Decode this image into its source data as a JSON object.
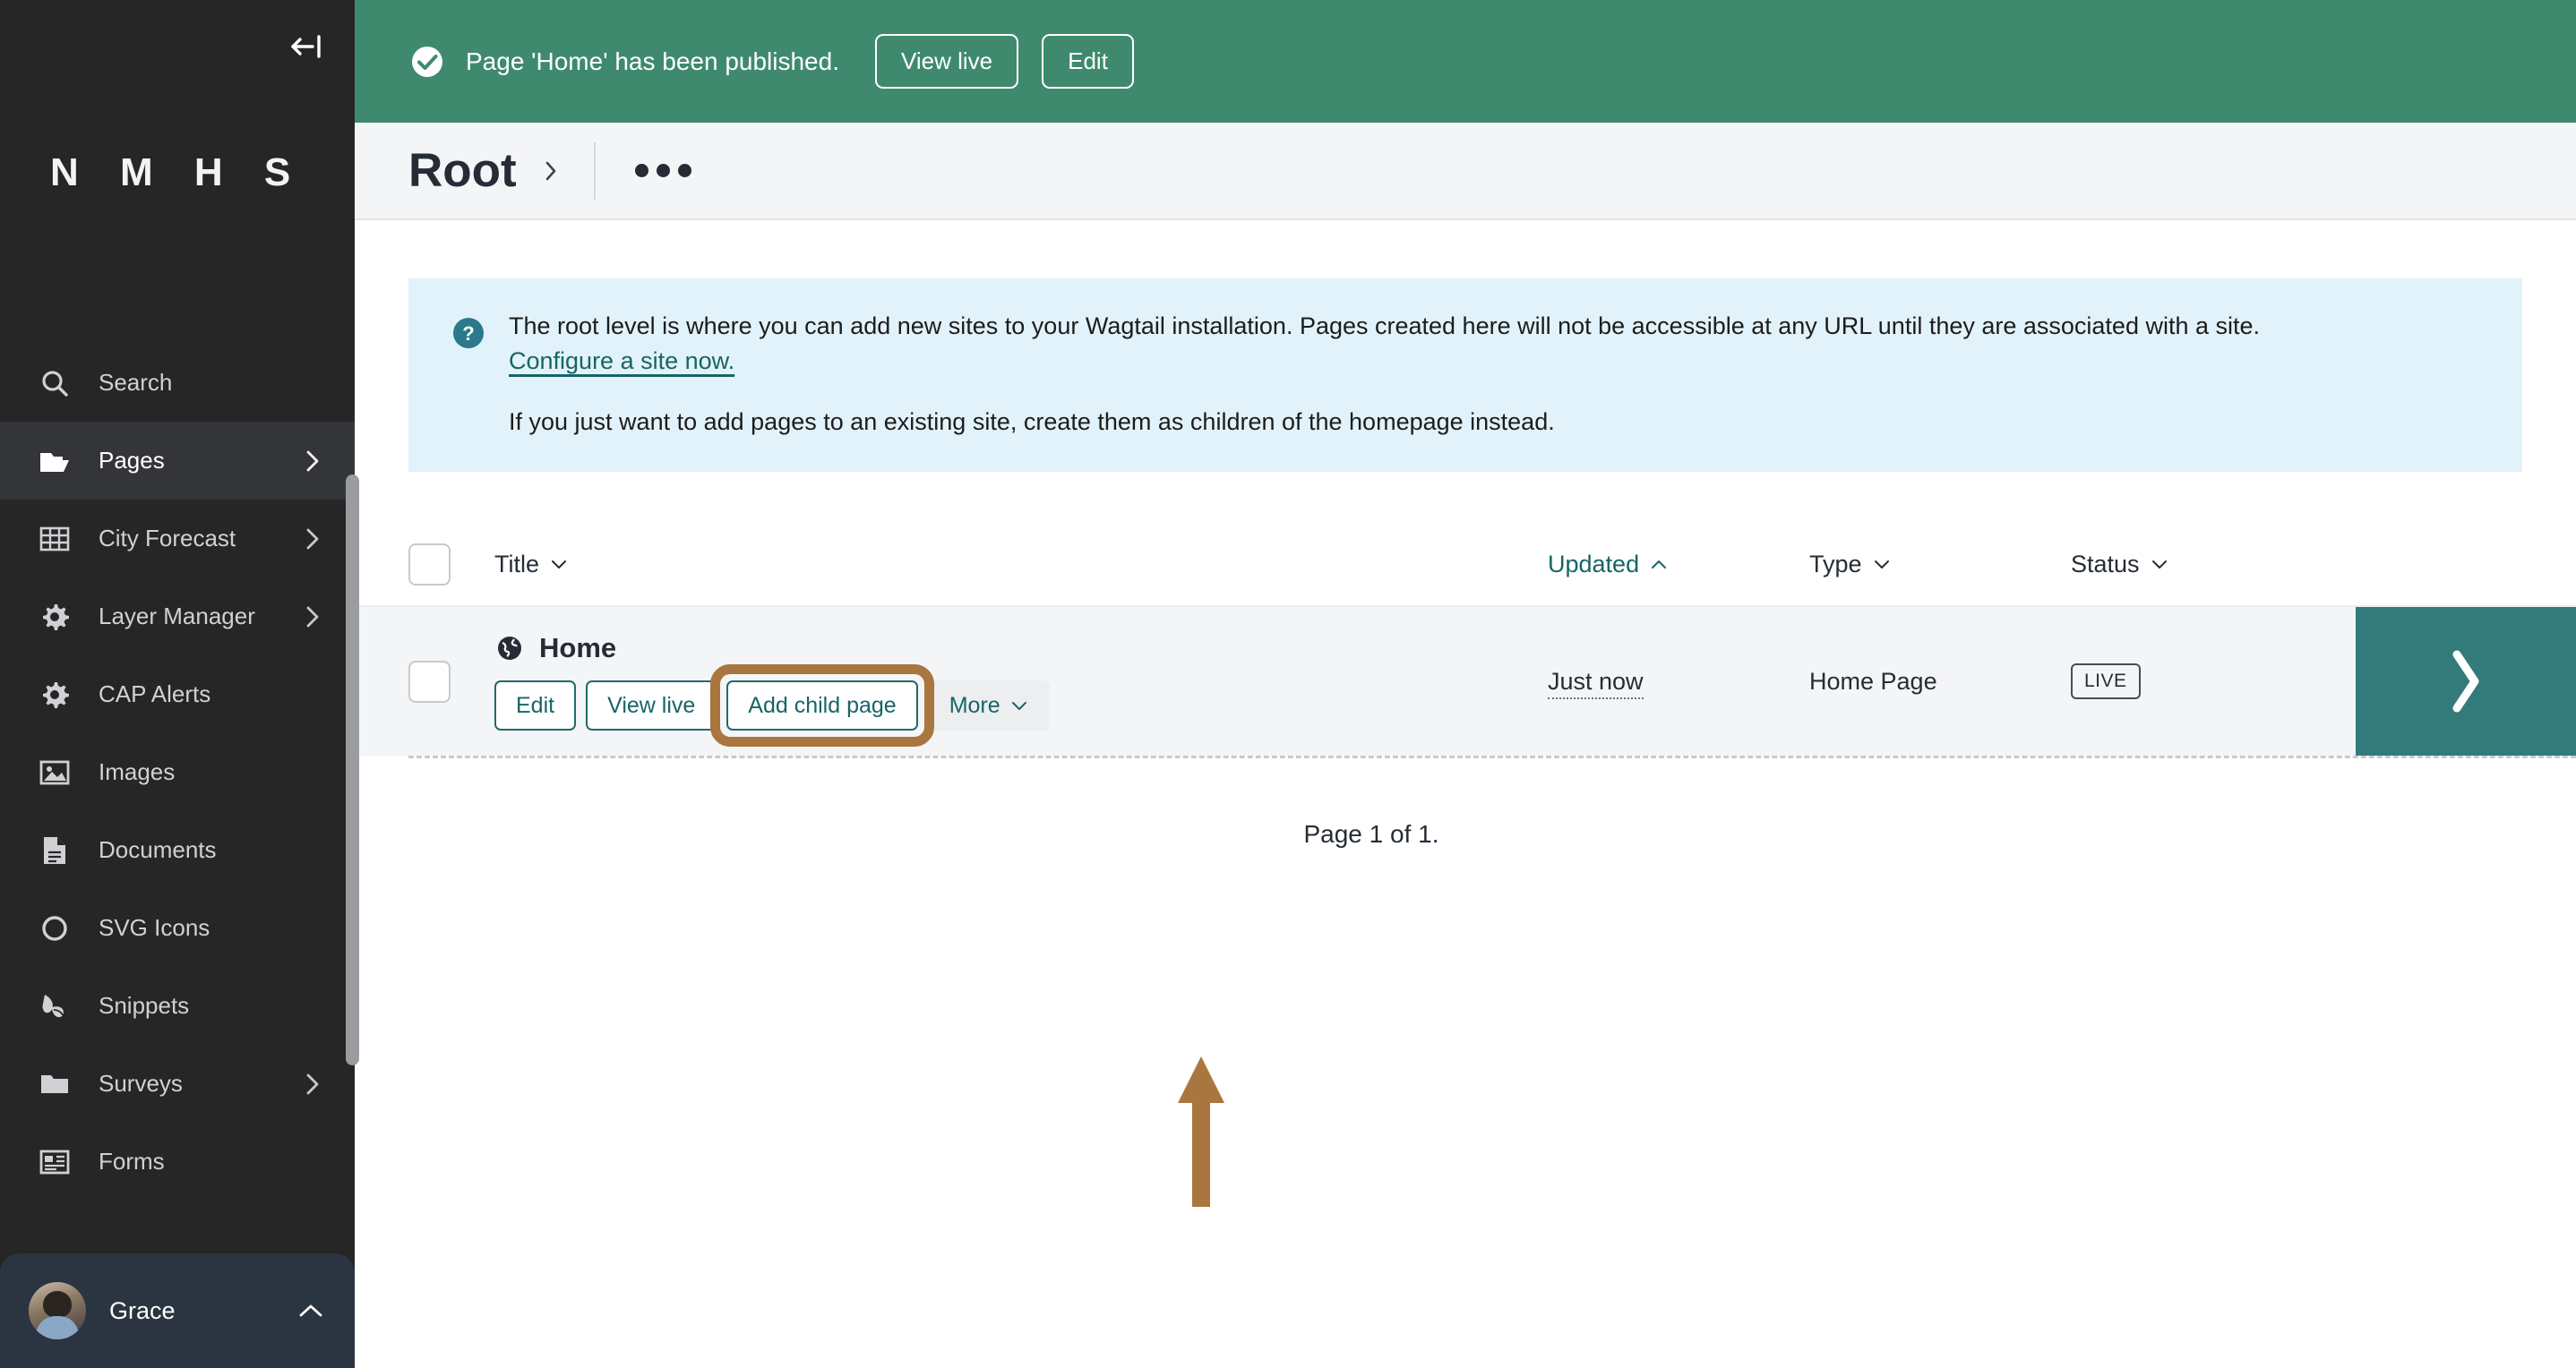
{
  "sidebar": {
    "collapse_icon": "collapse-left-icon",
    "brand": "N M H S",
    "items": [
      {
        "label": "Search",
        "icon": "search-icon",
        "active": false,
        "has_chevron": false
      },
      {
        "label": "Pages",
        "icon": "folder-open-icon",
        "active": true,
        "has_chevron": true
      },
      {
        "label": "City Forecast",
        "icon": "table-grid-icon",
        "active": false,
        "has_chevron": true
      },
      {
        "label": "Layer Manager",
        "icon": "cog-icon",
        "active": false,
        "has_chevron": true
      },
      {
        "label": "CAP Alerts",
        "icon": "cog-icon",
        "active": false,
        "has_chevron": false
      },
      {
        "label": "Images",
        "icon": "image-icon",
        "active": false,
        "has_chevron": false
      },
      {
        "label": "Documents",
        "icon": "document-icon",
        "active": false,
        "has_chevron": false
      },
      {
        "label": "SVG Icons",
        "icon": "circle-icon",
        "active": false,
        "has_chevron": false
      },
      {
        "label": "Snippets",
        "icon": "snippet-leaf-icon",
        "active": false,
        "has_chevron": false
      },
      {
        "label": "Surveys",
        "icon": "folder-icon",
        "active": false,
        "has_chevron": true
      },
      {
        "label": "Forms",
        "icon": "form-icon",
        "active": false,
        "has_chevron": false
      }
    ],
    "user": {
      "name": "Grace",
      "avatar": "user-avatar",
      "chevron": "chevron-up-icon"
    }
  },
  "banner": {
    "icon": "success-check-icon",
    "message": "Page 'Home' has been published.",
    "view_live_label": "View live",
    "edit_label": "Edit",
    "background": "#3f8a6e"
  },
  "header": {
    "title": "Root",
    "breadcrumb_chevron": "chevron-right-icon",
    "more_button": "more-options-icon"
  },
  "help": {
    "icon": "help-question-icon",
    "line1": "The root level is where you can add new sites to your Wagtail installation. Pages created here will not be accessible at any URL until they are associated with a site.",
    "link": "Configure a site now.",
    "line2": "If you just want to add pages to an existing site, create them as children of the homepage instead.",
    "background": "#e2f2fa",
    "link_color": "#176565"
  },
  "listing": {
    "columns": [
      {
        "label": "Title",
        "sort": "down",
        "active": false
      },
      {
        "label": "Updated",
        "sort": "up",
        "active": true
      },
      {
        "label": "Type",
        "sort": "down",
        "active": false
      },
      {
        "label": "Status",
        "sort": "down",
        "active": false
      }
    ],
    "rows": [
      {
        "title": "Home",
        "icon": "globe-site-icon",
        "updated": "Just now",
        "type": "Home Page",
        "status": "LIVE",
        "actions": [
          {
            "label": "Edit",
            "highlighted": false
          },
          {
            "label": "View live",
            "highlighted": false
          },
          {
            "label": "Add child page",
            "highlighted": true
          },
          {
            "label": "More",
            "highlighted": false
          }
        ],
        "children_chevron": "chevron-right-icon"
      }
    ],
    "pagination": "Page 1 of 1."
  },
  "annotation": {
    "arrow": "up-arrow-annotation",
    "color": "#a8763e",
    "target": "Add child page"
  }
}
